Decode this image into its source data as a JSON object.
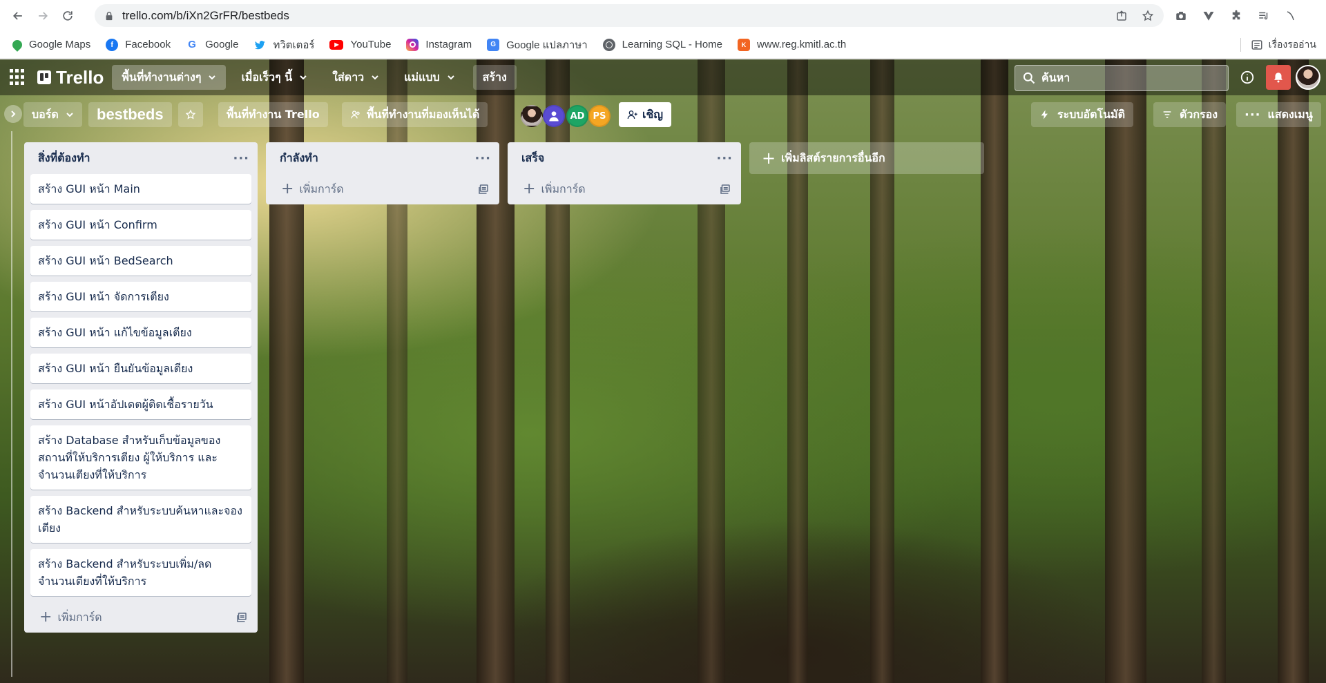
{
  "browser": {
    "url": "trello.com/b/iXn2GrFR/bestbeds",
    "bookmarks": [
      {
        "label": "Google Maps",
        "icon": "google-maps-icon",
        "color": "#34a853"
      },
      {
        "label": "Facebook",
        "icon": "facebook-icon",
        "color": "#1877f2"
      },
      {
        "label": "Google",
        "icon": "google-icon",
        "color": "#4285f4"
      },
      {
        "label": "ทวิตเตอร์",
        "icon": "twitter-icon",
        "color": "#1da1f2"
      },
      {
        "label": "YouTube",
        "icon": "youtube-icon",
        "color": "#ff0000"
      },
      {
        "label": "Instagram",
        "icon": "instagram-icon",
        "color": "#d6249f"
      },
      {
        "label": "Google แปลภาษา",
        "icon": "google-translate-icon",
        "color": "#4285f4"
      },
      {
        "label": "Learning SQL - Home",
        "icon": "globe-icon",
        "color": "#5f6368"
      },
      {
        "label": "www.reg.kmitl.ac.th",
        "icon": "kmitl-icon",
        "color": "#f26522"
      }
    ],
    "reading_list": "เรื่องรออ่าน"
  },
  "trello": {
    "logo": "Trello",
    "menu": [
      {
        "label": "พื้นที่ทำงานต่างๆ",
        "active": true
      },
      {
        "label": "เมื่อเร็วๆ นี้",
        "active": false
      },
      {
        "label": "ใส่ดาว",
        "active": false
      },
      {
        "label": "แม่แบบ",
        "active": false
      }
    ],
    "create": "สร้าง",
    "search_placeholder": "ค้นหา",
    "accent_notification": "#e2574c"
  },
  "board": {
    "view_switcher": "บอร์ด",
    "title": "bestbeds",
    "workspace": "พื้นที่ทำงาน Trello",
    "visibility": "พื้นที่ทำงานที่มองเห็นได้",
    "members": [
      {
        "initials": "",
        "color": "#c08d75",
        "kind": "photo"
      },
      {
        "initials": "",
        "color": "#5a4bd3",
        "kind": "default"
      },
      {
        "initials": "AD",
        "color": "#1ea564"
      },
      {
        "initials": "PS",
        "color": "#f5a623"
      }
    ],
    "invite": "เชิญ",
    "automation": "ระบบอัตโนมัติ",
    "filter": "ตัวกรอง",
    "show_menu": "แสดงเมนู",
    "add_list": "เพิ่มลิสต์รายการอื่นอีก",
    "lists": [
      {
        "title": "สิ่งที่ต้องทำ",
        "cards": [
          "สร้าง GUI หน้า Main",
          "สร้าง GUI หน้า Confirm",
          "สร้าง GUI หน้า BedSearch",
          "สร้าง GUI หน้า จัดการเตียง",
          "สร้าง GUI หน้า แก้ไขข้อมูลเตียง",
          "สร้าง GUI หน้า ยืนยันข้อมูลเตียง",
          "สร้าง GUI หน้าอัปเดตผู้ติดเชื้อรายวัน",
          "สร้าง Database สำหรับเก็บข้อมูลของ สถานที่ให้บริการเตียง ผู้ให้บริการ และจำนวนเตียงที่ให้บริการ",
          "สร้าง Backend สำหรับระบบค้นหาและจองเตียง",
          "สร้าง Backend สำหรับระบบเพิ่ม/ลดจำนวนเตียงที่ให้บริการ"
        ],
        "add_card": "เพิ่มการ์ด"
      },
      {
        "title": "กำลังทำ",
        "cards": [],
        "add_card": "เพิ่มการ์ด"
      },
      {
        "title": "เสร็จ",
        "cards": [],
        "add_card": "เพิ่มการ์ด"
      }
    ]
  }
}
